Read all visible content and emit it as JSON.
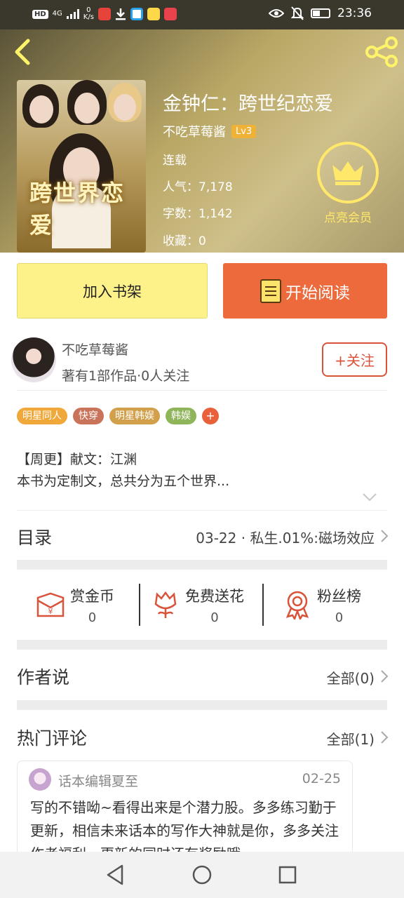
{
  "status_bar": {
    "chip_hd": "HD",
    "network": "4G",
    "speed_value": "0",
    "speed_unit": "K/s",
    "time": "23:36",
    "battery_fraction": 0.4
  },
  "hero": {
    "cover_title": "跨世界恋爱",
    "title": "金钟仁：跨世纪恋爱",
    "author": "不吃草莓酱",
    "level": "Lv3",
    "status": "连载",
    "popularity": "人气：7,178",
    "word_count": "字数：1,142",
    "favorites": "收藏：0",
    "vip_label": "点亮会员"
  },
  "actions": {
    "add_shelf": "加入书架",
    "start_read": "开始阅读"
  },
  "author_info": {
    "name": "不吃草莓酱",
    "stats": "著有1部作品·0人关注",
    "follow": "+关注"
  },
  "tags": [
    {
      "label": "明星同人",
      "color": "#f0a83a"
    },
    {
      "label": "快穿",
      "color": "#c9735a"
    },
    {
      "label": "明星韩娱",
      "color": "#d2a04a"
    },
    {
      "label": "韩娱",
      "color": "#8fb55a"
    }
  ],
  "tag_more": "+",
  "description": {
    "line1": "【周更】献文：江渊",
    "line2": "本书为定制文，总共分为五个世界..."
  },
  "catalog": {
    "title": "目录",
    "latest": "03-22 · 私生.01%:磁场效应"
  },
  "stats": [
    {
      "label": "赏金币",
      "value": "0"
    },
    {
      "label": "免费送花",
      "value": "0"
    },
    {
      "label": "粉丝榜",
      "value": "0"
    }
  ],
  "author_say": {
    "title": "作者说",
    "all": "全部(0)"
  },
  "hot_comments": {
    "title": "热门评论",
    "all": "全部(1)"
  },
  "comment": {
    "user": "话本编辑夏至",
    "date": "02-25",
    "text": "写的不错呦~看得出来是个潜力股。多多练习勤于更新，相信未来话本的写作大神就是你，多多关注作者福利，更新的同时还有奖励哦~"
  },
  "colors": {
    "accent_orange": "#ec6a3c",
    "shelf_yellow": "#fdf28a",
    "follow_red": "#d9533b",
    "vip_gold": "#ffe86a"
  }
}
